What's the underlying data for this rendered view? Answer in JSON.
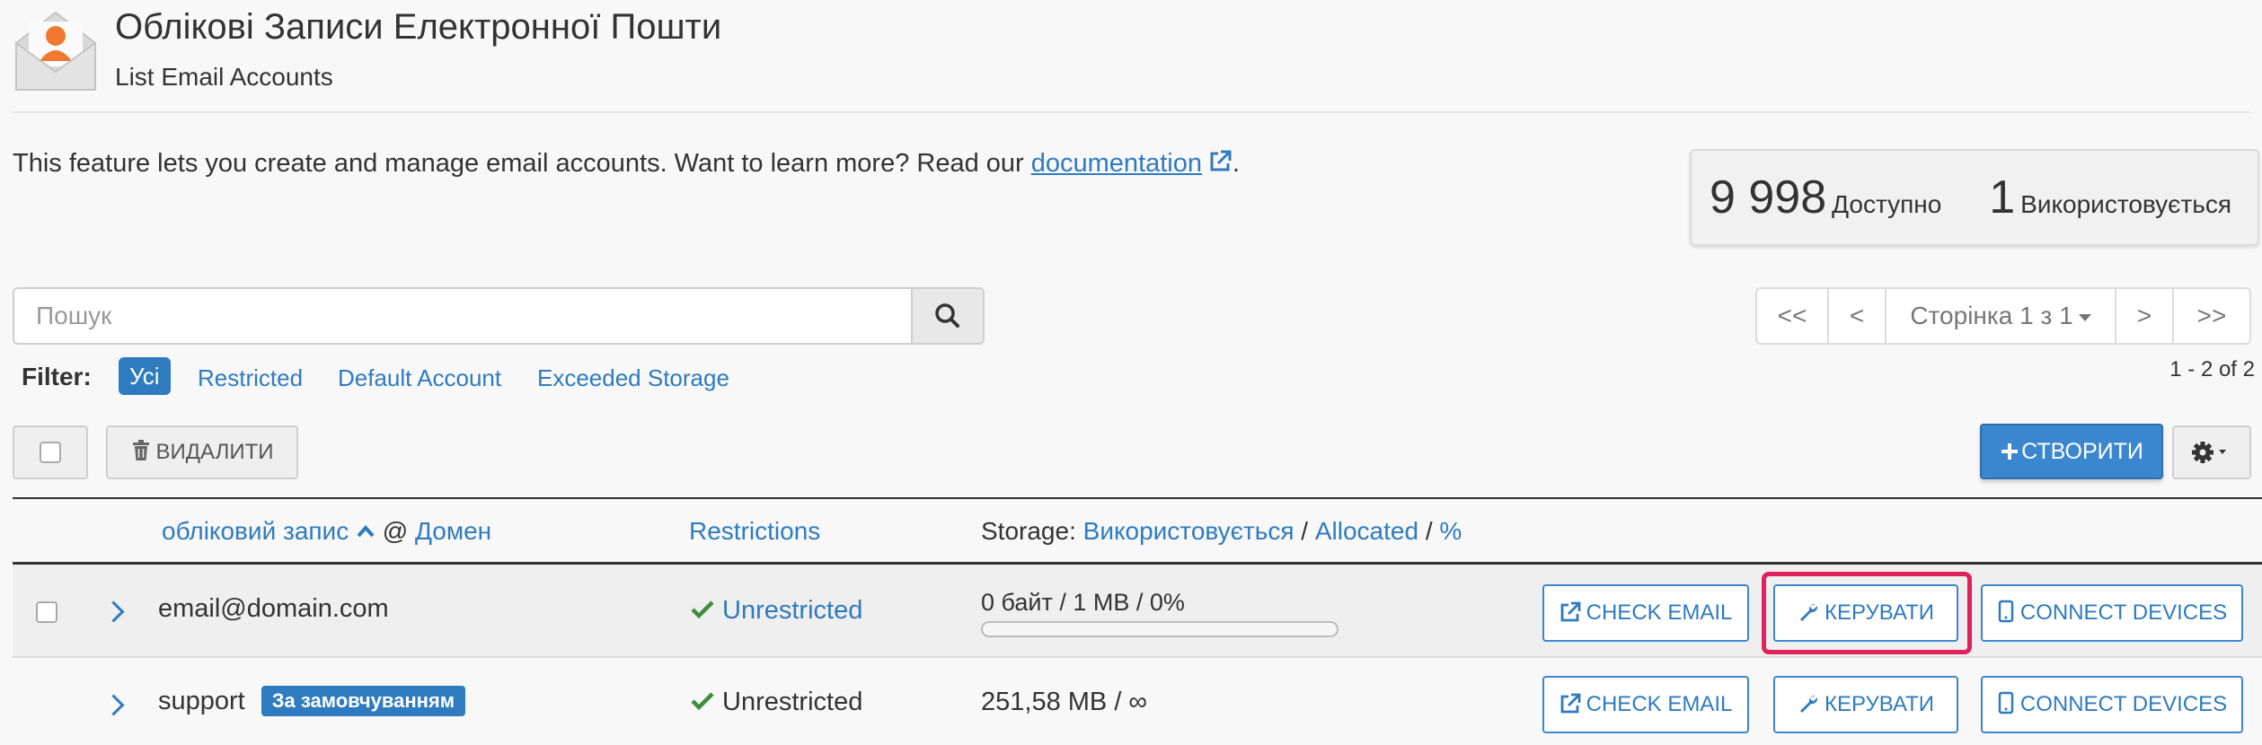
{
  "header": {
    "title": "Облікові Записи Електронної Пошти",
    "subtitle": "List Email Accounts"
  },
  "intro": {
    "text": "This feature lets you create and manage email accounts. Want to learn more? Read our",
    "link": "documentation",
    "period": "."
  },
  "stats": {
    "available_num": "9 998",
    "available_label": "Доступно",
    "used_num": "1",
    "used_label": "Використовується"
  },
  "search": {
    "placeholder": "Пошук"
  },
  "pagination": {
    "first": "<<",
    "prev": "<",
    "page_label": "Сторінка 1 з 1",
    "next": ">",
    "last": ">>",
    "count": "1 - 2 of 2"
  },
  "filter": {
    "label": "Filter:",
    "options": [
      "Усі",
      "Restricted",
      "Default Account",
      "Exceeded Storage"
    ],
    "active": "Усі"
  },
  "toolbar": {
    "delete_label": "ВИДАЛИТИ",
    "create_label": "СТВОРИТИ"
  },
  "table": {
    "col_account": "обліковий запис",
    "col_at": "@",
    "col_domain": "Домен",
    "col_restrictions": "Restrictions",
    "col_storage_prefix": "Storage:",
    "col_storage_used": "Використовується",
    "col_storage_sep1": "/",
    "col_storage_allocated": "Allocated",
    "col_storage_sep2": "/",
    "col_storage_pct": "%",
    "rows": [
      {
        "account": "email@domain.com",
        "badge": "",
        "restriction": "Unrestricted",
        "storage": "0 байт / 1 MB / 0%",
        "usage_fraction": 0,
        "check_email": "CHECK EMAIL",
        "manage": "КЕРУВАТИ",
        "connect": "CONNECT DEVICES"
      },
      {
        "account": "support",
        "badge": "За замовчуванням",
        "restriction": "Unrestricted",
        "storage": "251,58 MB / ∞",
        "check_email": "CHECK EMAIL",
        "manage": "КЕРУВАТИ",
        "connect": "CONNECT DEVICES"
      }
    ]
  },
  "colors": {
    "accent": "#2f7bbf",
    "highlight": "#e0215f",
    "success": "#3c8f3c"
  }
}
